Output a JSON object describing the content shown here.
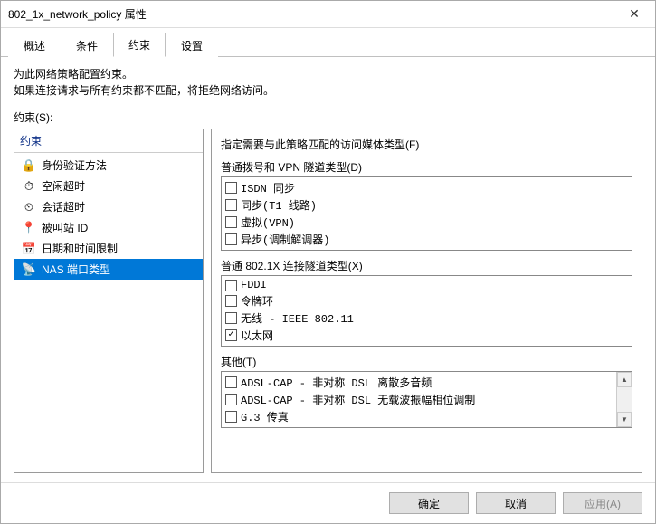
{
  "window": {
    "title": "802_1x_network_policy 属性",
    "close": "✕"
  },
  "tabs": {
    "items": [
      {
        "label": "概述"
      },
      {
        "label": "条件"
      },
      {
        "label": "约束"
      },
      {
        "label": "设置"
      }
    ]
  },
  "description": {
    "line1": "为此网络策略配置约束。",
    "line2": "如果连接请求与所有约束都不匹配，将拒绝网络访问。"
  },
  "constraints_label": "约束(S):",
  "left": {
    "header": "约束",
    "items": [
      {
        "icon": "🔒",
        "label": "身份验证方法"
      },
      {
        "icon": "⏱",
        "label": "空闲超时"
      },
      {
        "icon": "⏲",
        "label": "会话超时"
      },
      {
        "icon": "📍",
        "label": "被叫站 ID"
      },
      {
        "icon": "📅",
        "label": "日期和时间限制"
      },
      {
        "icon": "📡",
        "label": "NAS 端口类型"
      }
    ]
  },
  "right": {
    "heading": "指定需要与此策略匹配的访问媒体类型(F)",
    "group1_label": "普通拨号和 VPN 隧道类型(D)",
    "group1_items": [
      {
        "label": "ISDN 同步",
        "checked": false
      },
      {
        "label": "同步(T1 线路)",
        "checked": false
      },
      {
        "label": "虚拟(VPN)",
        "checked": false
      },
      {
        "label": "异步(调制解调器)",
        "checked": false
      }
    ],
    "group2_label": "普通 802.1X 连接隧道类型(X)",
    "group2_items": [
      {
        "label": "FDDI",
        "checked": false
      },
      {
        "label": "令牌环",
        "checked": false
      },
      {
        "label": "无线 - IEEE 802.11",
        "checked": false
      },
      {
        "label": "以太网",
        "checked": true
      }
    ],
    "group3_label": "其他(T)",
    "group3_items": [
      {
        "label": "ADSL-CAP - 非对称 DSL 离散多音频",
        "checked": false
      },
      {
        "label": "ADSL-CAP - 非对称 DSL 无载波振幅相位调制",
        "checked": false
      },
      {
        "label": "G.3 传真",
        "checked": false
      }
    ]
  },
  "buttons": {
    "ok": "确定",
    "cancel": "取消",
    "apply": "应用(A)"
  },
  "glyph": {
    "up": "▲",
    "down": "▼"
  }
}
